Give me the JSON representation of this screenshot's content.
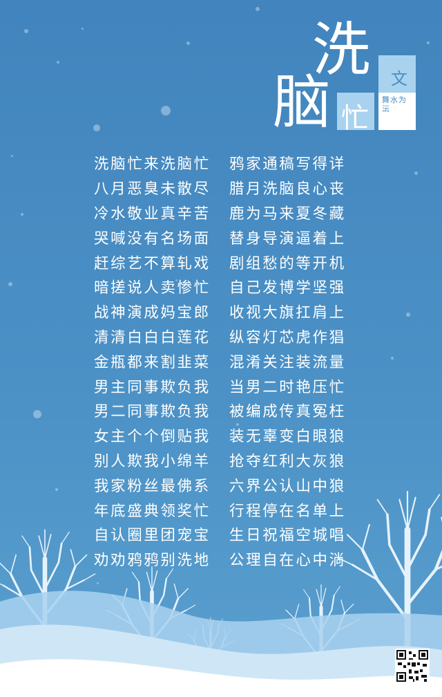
{
  "title": {
    "char1": "洗",
    "char2": "脑",
    "char3": "忙",
    "char4": "文",
    "small": "舞水为沄"
  },
  "poem": [
    [
      "洗脑忙来洗脑忙",
      "鸦家通稿写得详"
    ],
    [
      "八月恶臭未散尽",
      "腊月洗脑良心丧"
    ],
    [
      "冷水敬业真辛苦",
      "鹿为马来夏冬藏"
    ],
    [
      "哭喊没有名场面",
      "替身导演逼着上"
    ],
    [
      "赶综艺不算轧戏",
      "剧组愁的等开机"
    ],
    [
      "暗搓说人卖惨忙",
      "自己发博学坚强"
    ],
    [
      "战神演成妈宝郎",
      "收视大旗扛肩上"
    ],
    [
      "清清白白白莲花",
      "纵容灯芯虎作猖"
    ],
    [
      "金瓶都来割韭菜",
      "混淆关注装流量"
    ],
    [
      "男主同事欺负我",
      "当男二时艳压忙"
    ],
    [
      "男二同事欺负我",
      "被编成传真冤枉"
    ],
    [
      "女主个个倒贴我",
      "装无辜变白眼狼"
    ],
    [
      "别人欺我小绵羊",
      "抢夺红利大灰狼"
    ],
    [
      "我家粉丝最佛系",
      "六界公认山中狼"
    ],
    [
      "年底盛典领奖忙",
      "行程停在名单上"
    ],
    [
      "自认圈里团宠宝",
      "生日祝福空城唱"
    ],
    [
      "劝劝鸦鸦别洗地",
      "公理自在心中淌"
    ]
  ],
  "colors": {
    "background": "#4a8fc4",
    "accent_light": "#a9d2ee",
    "text": "#ffffff"
  }
}
